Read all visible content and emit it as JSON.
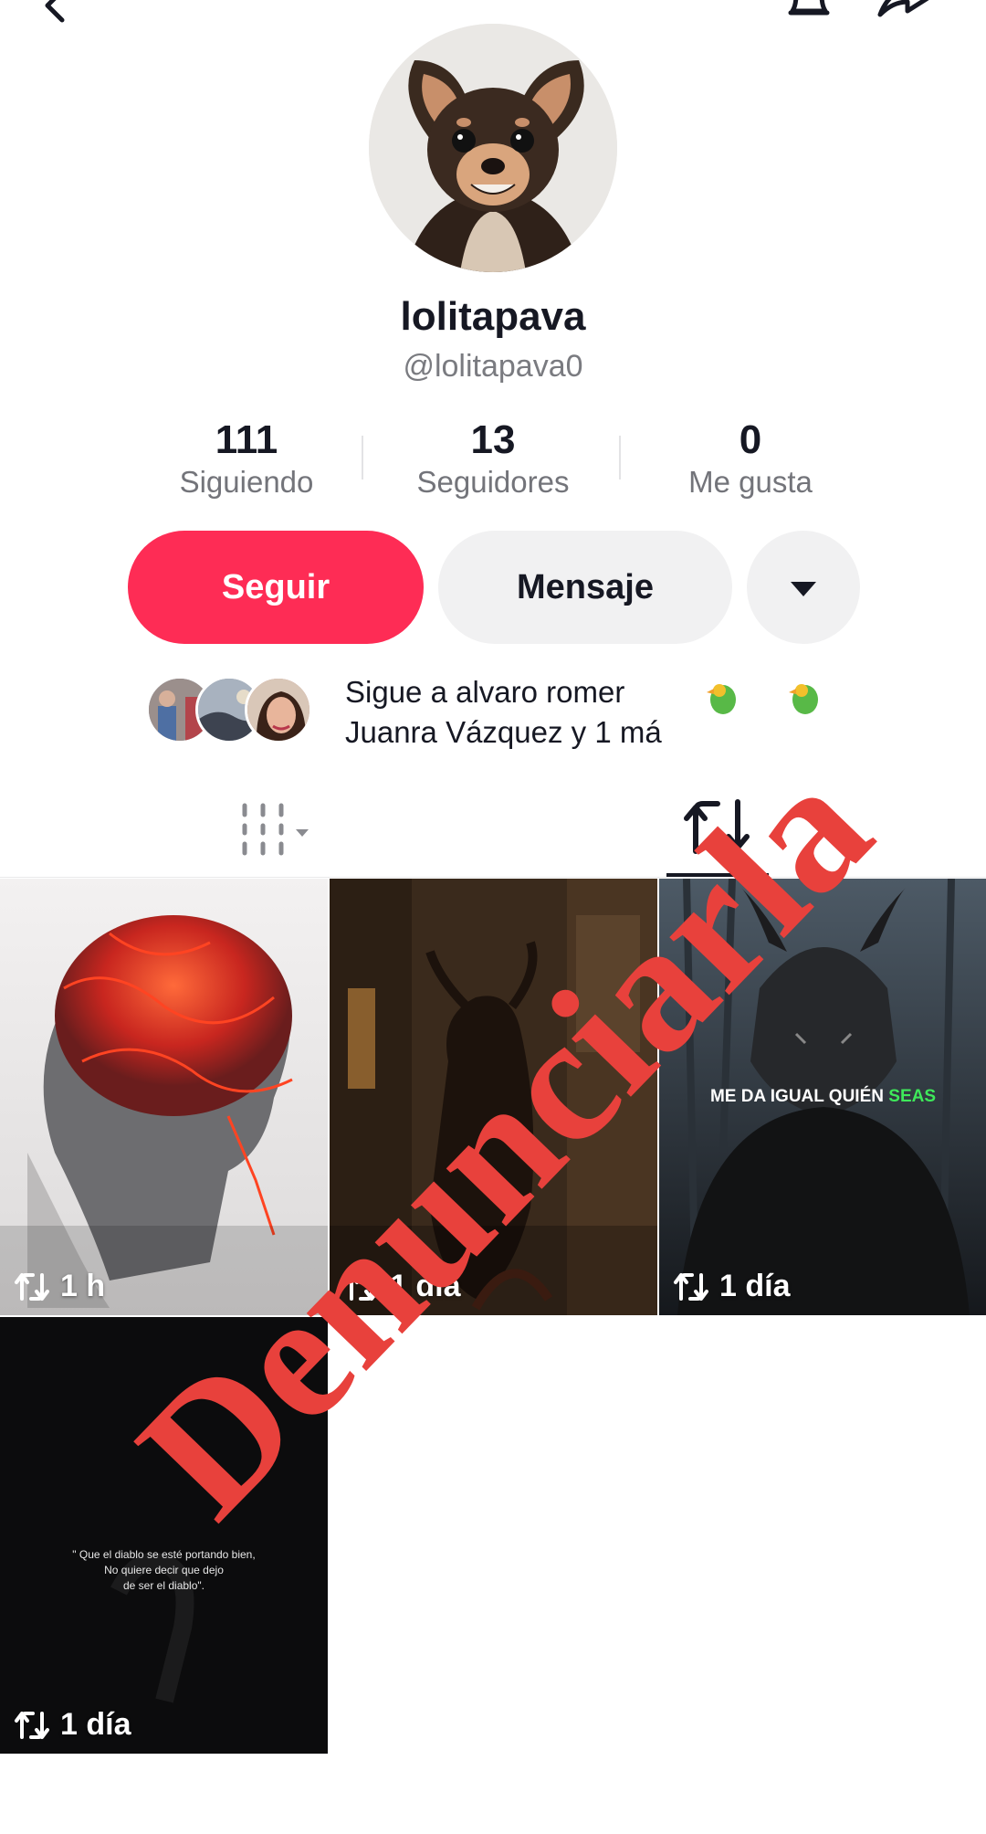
{
  "profile": {
    "display_name": "lolitapava",
    "username": "@lolitapava0"
  },
  "stats": [
    {
      "value": "111",
      "label": "Siguiendo"
    },
    {
      "value": "13",
      "label": "Seguidores"
    },
    {
      "value": "0",
      "label": "Me gusta"
    }
  ],
  "actions": {
    "follow_label": "Seguir",
    "message_label": "Mensaje"
  },
  "suggestion": {
    "line1": "Sigue a alvaro romer",
    "line2": "Juanra Vázquez y 1 má"
  },
  "videos": [
    {
      "meta": "1 h",
      "caption": ""
    },
    {
      "meta": "1 día",
      "caption": ""
    },
    {
      "meta": "1 día",
      "caption_a": "ME DA IGUAL QUIÉN",
      "caption_b": "SEAS"
    },
    {
      "meta": "1 día",
      "quote1": "\" Que el diablo se esté portando bien,",
      "quote2": "No quiere decir que dejo",
      "quote3": "de ser el diablo\"."
    }
  ],
  "watermark": {
    "text": "Denunciarla",
    "color": "#e8413c"
  },
  "colors": {
    "follow": "#fe2c55",
    "secondary_button": "#f1f1f2",
    "accent_green": "#3ee85a"
  }
}
